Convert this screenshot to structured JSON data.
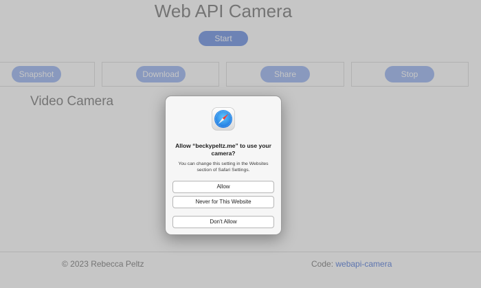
{
  "page": {
    "title": "Web API Camera",
    "start_label": "Start",
    "buttons": [
      {
        "label": "Snapshot"
      },
      {
        "label": "Download"
      },
      {
        "label": "Share"
      },
      {
        "label": "Stop"
      }
    ],
    "section_heading": "Video Camera"
  },
  "footer": {
    "copyright": "© 2023 Rebecca Peltz",
    "code_label": "Code: ",
    "code_link": "webapi-camera"
  },
  "dialog": {
    "app_icon": "safari-compass-icon",
    "prompt": "Allow “beckypeltz.me” to use your camera?",
    "subtext": "You can change this setting in the Websites section of Safari Settings.",
    "allow_label": "Allow",
    "never_label": "Never for This Website",
    "dont_allow_label": "Don't Allow"
  },
  "colors": {
    "accent": "#5d86e0",
    "overlay": "#808080",
    "link": "#3f6bd6"
  }
}
